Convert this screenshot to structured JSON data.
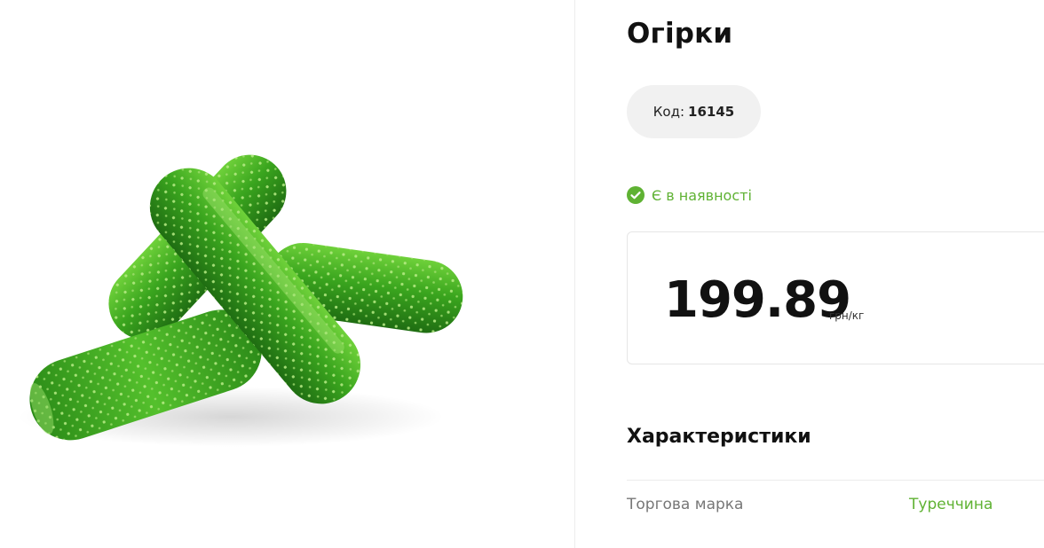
{
  "product": {
    "title": "Огірки",
    "code_label": "Код:",
    "code_value": "16145",
    "availability": "Є в наявності",
    "price": "199.89",
    "price_unit": "грн/кг",
    "image_icon": "cucumber-image"
  },
  "characteristics": {
    "heading": "Характеристики",
    "rows": [
      {
        "label": "Торгова марка",
        "value": "Туреччина"
      }
    ]
  },
  "colors": {
    "accent_green": "#5fb233",
    "pill_bg": "#f1f1f1",
    "border": "#e6e6e6"
  }
}
